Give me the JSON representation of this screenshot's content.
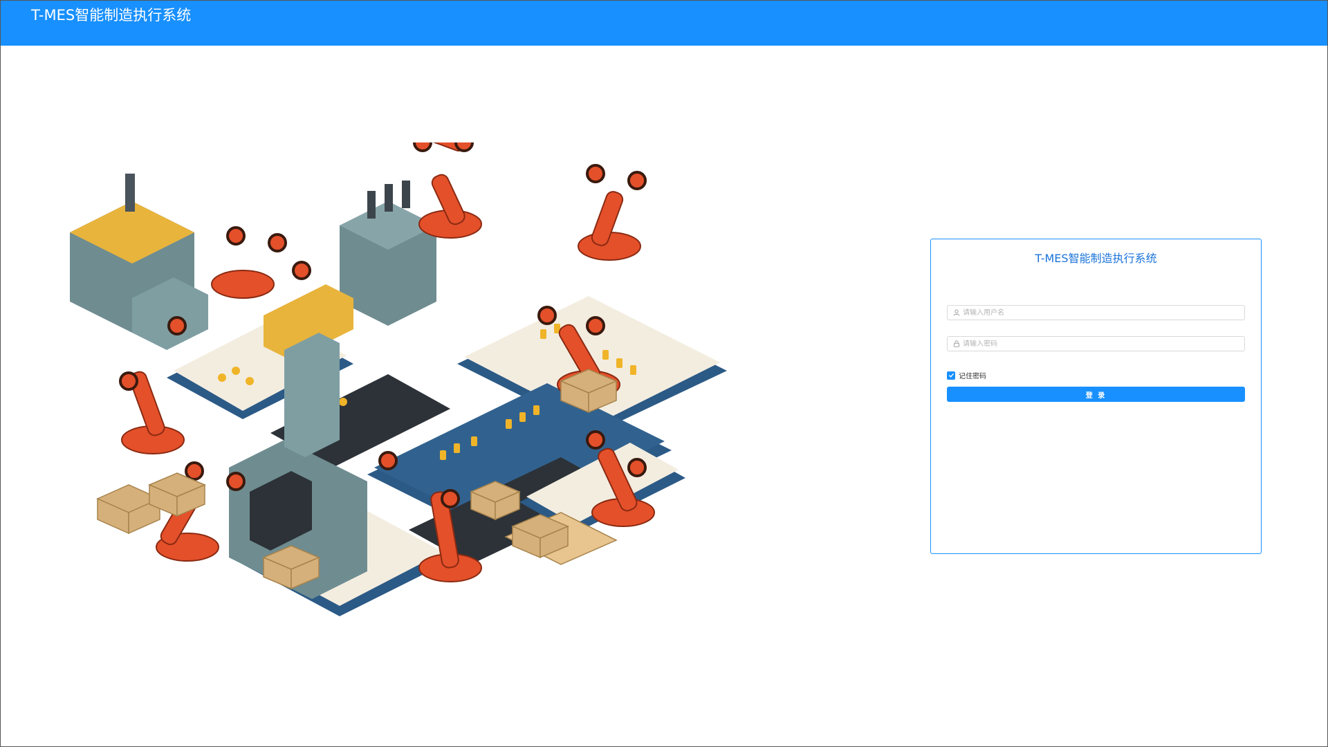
{
  "header": {
    "title": "T-MES智能制造执行系统"
  },
  "login": {
    "title": "T-MES智能制造执行系统",
    "username_placeholder": "请输入用户名",
    "password_placeholder": "请输入密码",
    "remember_label": "记住密码",
    "remember_checked": true,
    "submit_label": "登 录"
  },
  "icons": {
    "username": "user-icon",
    "password": "lock-icon",
    "remember": "checkmark-icon"
  },
  "colors": {
    "brand": "#1890ff",
    "robot_arm": "#e4502a",
    "machine": "#7e9ea2",
    "conveyor": "#2c5a86",
    "box": "#d6b07a"
  }
}
